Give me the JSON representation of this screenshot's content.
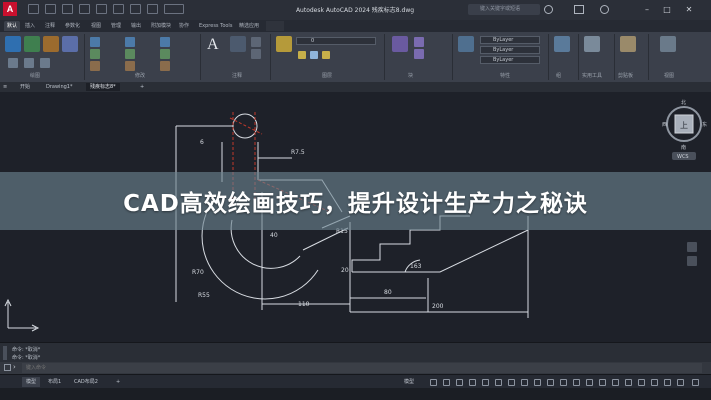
{
  "app": {
    "logo_text": "A",
    "window_title": "Autodesk AutoCAD 2024   残疾标志8.dwg",
    "search_placeholder": "键入关键字或短语"
  },
  "ribbon_tabs": [
    "默认",
    "插入",
    "注释",
    "参数化",
    "视图",
    "管理",
    "输出",
    "附加模块",
    "协作",
    "Express Tools",
    "精选应用"
  ],
  "ribbon": {
    "layer_name": "0",
    "bylayer": "ByLayer",
    "groups": [
      "绘图",
      "修改",
      "注释",
      "图层",
      "块",
      "特性",
      "组",
      "实用工具",
      "剪贴板",
      "视图"
    ]
  },
  "doc_tabs": [
    "开始",
    "Drawing1*",
    "残疾标志8*"
  ],
  "drawing": {
    "dimensions": [
      "R7.5",
      "40",
      "R15",
      "20",
      "R70",
      "R55",
      "110",
      "80",
      "200",
      "163",
      "6"
    ]
  },
  "viewcube": {
    "face": "上",
    "n": "北",
    "s": "南",
    "e": "东",
    "w": "西",
    "wcs": "WCS"
  },
  "banner": {
    "text": "CAD高效绘画技巧，提升设计生产力之秘诀"
  },
  "command": {
    "history": [
      "命令: *取消*",
      "命令: *取消*"
    ],
    "input_placeholder": "键入命令"
  },
  "status": {
    "tabs": [
      "模型",
      "布局1",
      "CAD布局2"
    ],
    "model_label": "模型"
  },
  "colors": {
    "accent": "#c8102e",
    "drawing_bg": "#1e2129",
    "banner": "#6c8491",
    "hidden_line": "#c0392b"
  }
}
